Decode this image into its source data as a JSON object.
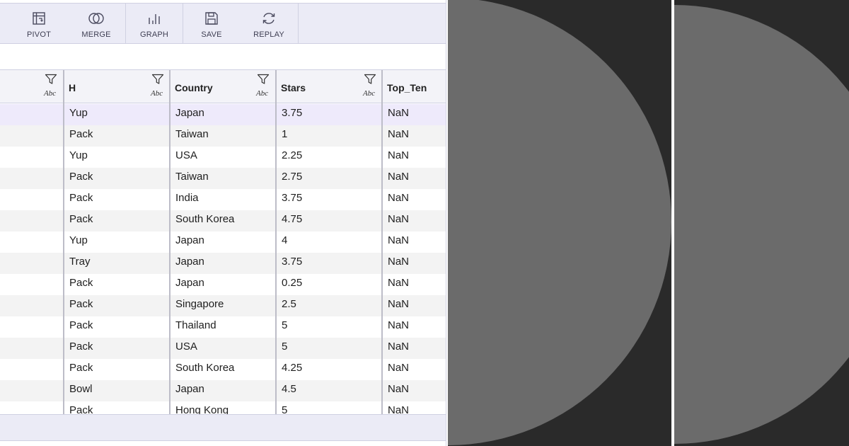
{
  "toolbar": {
    "items": [
      {
        "label": "PIVOT",
        "icon": "pivot-icon"
      },
      {
        "label": "MERGE",
        "icon": "merge-icon"
      },
      {
        "label": "GRAPH",
        "icon": "graph-icon"
      },
      {
        "label": "SAVE",
        "icon": "save-icon"
      },
      {
        "label": "REPLAY",
        "icon": "replay-icon"
      }
    ]
  },
  "grid": {
    "columns": [
      {
        "name": "H",
        "type": "Abc"
      },
      {
        "name": "Country",
        "type": "Abc"
      },
      {
        "name": "Stars",
        "type": "Abc"
      },
      {
        "name": "Top_Ten",
        "type": "Abc"
      }
    ],
    "leading_column_type": "Abc",
    "rows": [
      [
        "Yup",
        "Japan",
        "3.75",
        "NaN"
      ],
      [
        "Pack",
        "Taiwan",
        "1",
        "NaN"
      ],
      [
        "Yup",
        "USA",
        "2.25",
        "NaN"
      ],
      [
        "Pack",
        "Taiwan",
        "2.75",
        "NaN"
      ],
      [
        "Pack",
        "India",
        "3.75",
        "NaN"
      ],
      [
        "Pack",
        "South Korea",
        "4.75",
        "NaN"
      ],
      [
        "Yup",
        "Japan",
        "4",
        "NaN"
      ],
      [
        "Tray",
        "Japan",
        "3.75",
        "NaN"
      ],
      [
        "Pack",
        "Japan",
        "0.25",
        "NaN"
      ],
      [
        "Pack",
        "Singapore",
        "2.5",
        "NaN"
      ],
      [
        "Pack",
        "Thailand",
        "5",
        "NaN"
      ],
      [
        "Pack",
        "USA",
        "5",
        "NaN"
      ],
      [
        "Pack",
        "South Korea",
        "4.25",
        "NaN"
      ],
      [
        "Bowl",
        "Japan",
        "4.5",
        "NaN"
      ],
      [
        "Pack",
        "Hong Kong",
        "5",
        "NaN"
      ]
    ]
  },
  "colors": {
    "toolbar_bg": "#ebebf6",
    "selected_row_bg": "#eeeafb",
    "stripe_bg": "#f3f3f3",
    "panel_bg": "#2a2a2a",
    "disc_fill": "#6b6b6b"
  }
}
